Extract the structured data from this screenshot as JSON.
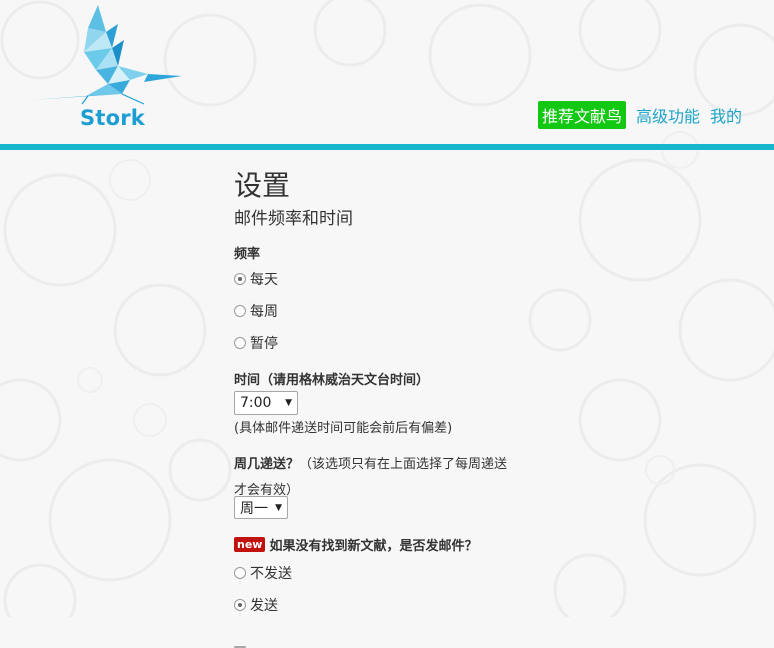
{
  "brand": {
    "name": "Stork",
    "color": "#1d9ed3",
    "icon": "stork-origami-logo"
  },
  "nav": {
    "items": [
      {
        "label": "推荐文献鸟",
        "active": true
      },
      {
        "label": "高级功能",
        "active": false
      },
      {
        "label": "我的",
        "active": false
      }
    ]
  },
  "colors": {
    "accent": "#18b6cc",
    "active_nav": "#12c812",
    "new_badge": "#c1120d"
  },
  "page": {
    "title": "设置",
    "subtitle": "邮件频率和时间"
  },
  "frequency": {
    "label": "频率",
    "options": [
      {
        "label": "每天",
        "checked": true
      },
      {
        "label": "每周",
        "checked": false
      },
      {
        "label": "暂停",
        "checked": false
      }
    ]
  },
  "time": {
    "label": "时间（请用格林威治天文台时间）",
    "value": "7:00",
    "note": "(具体邮件递送时间可能会前后有偏差)"
  },
  "weekday": {
    "label": "周几递送？",
    "hint_line1": "（该选项只有在上面选择了每周递送",
    "hint_line2": "才会有效）",
    "value": "周一"
  },
  "no_new": {
    "badge": "new",
    "label": "如果没有找到新文献，是否发邮件？",
    "options": [
      {
        "label": "不发送",
        "checked": false
      },
      {
        "label": "发送",
        "checked": true
      }
    ]
  }
}
